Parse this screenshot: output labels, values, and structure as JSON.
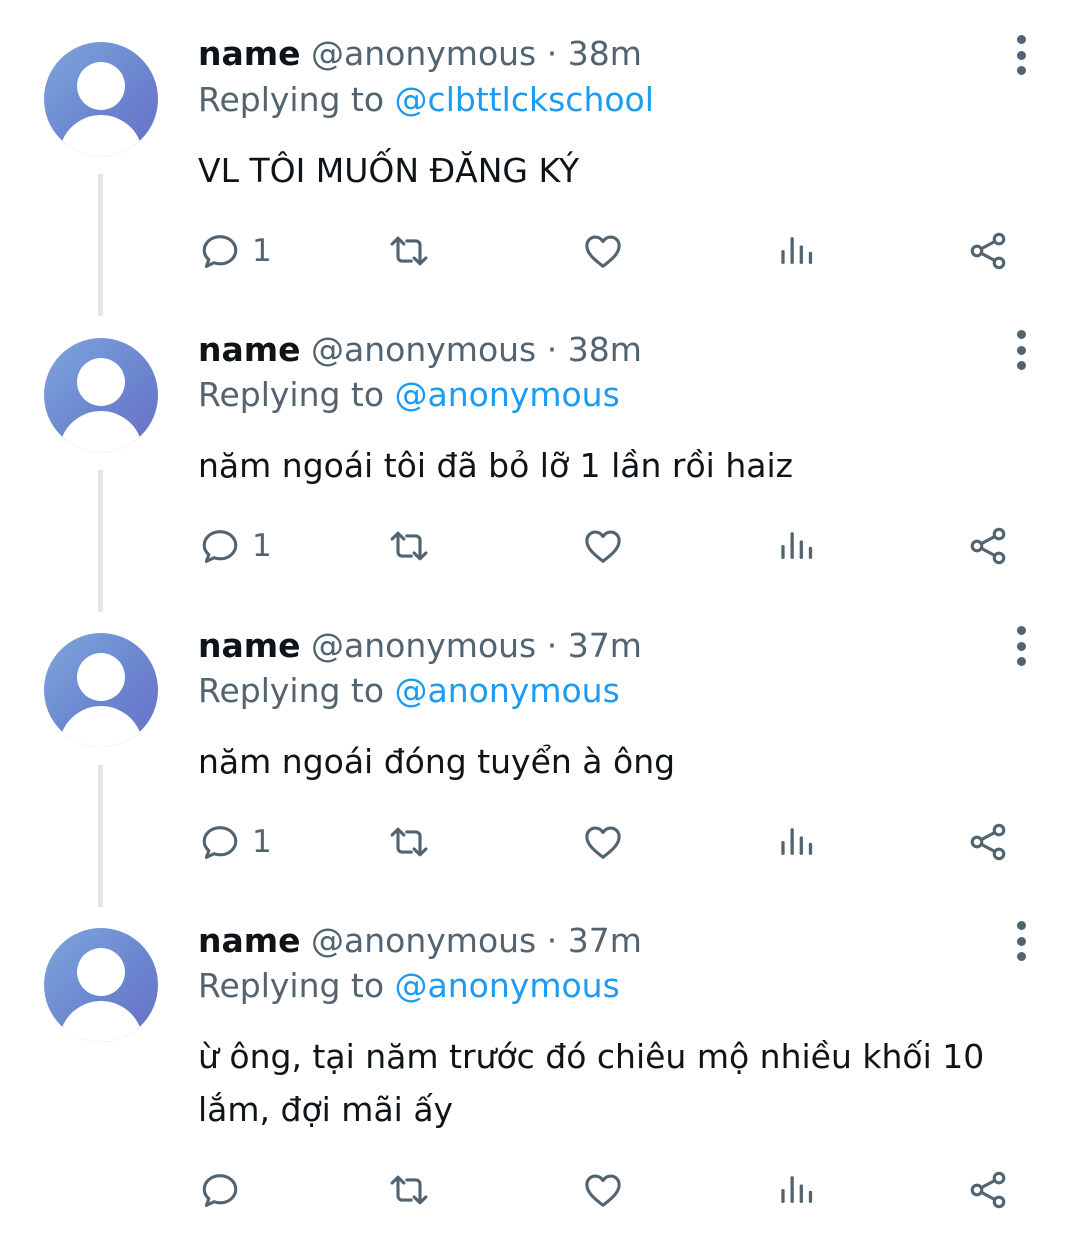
{
  "tweets": [
    {
      "name": "name",
      "handle_time": "@anonymous · 38m",
      "replying_prefix": "Replying to ",
      "replying_to": "@clbttlckschool",
      "text": "VL TÔI MUỐN ĐĂNG KÝ",
      "reply_count": "1"
    },
    {
      "name": "name",
      "handle_time": "@anonymous · 38m",
      "replying_prefix": "Replying to ",
      "replying_to": "@anonymous",
      "text": "năm ngoái tôi đã bỏ lỡ 1 lần rồi haiz",
      "reply_count": "1"
    },
    {
      "name": "name",
      "handle_time": "@anonymous · 37m",
      "replying_prefix": "Replying to ",
      "replying_to": "@anonymous",
      "text": "năm ngoái đóng tuyển à ông",
      "reply_count": "1"
    },
    {
      "name": "name",
      "handle_time": "@anonymous · 37m",
      "replying_prefix": "Replying to ",
      "replying_to": "@anonymous",
      "text": "ừ ông, tại năm trước đó chiêu mộ nhiều khối 10 lắm, đợi mãi ấy",
      "reply_count": ""
    }
  ],
  "icons": {
    "reply": "reply-icon",
    "retweet": "retweet-icon",
    "like": "heart-icon",
    "views": "views-icon",
    "share": "share-icon",
    "more": "more-options-icon"
  },
  "colors": {
    "accent": "#1d9bf0",
    "secondary_text": "#536471",
    "icon": "#536471",
    "thread_line": "#e3e6e9"
  }
}
